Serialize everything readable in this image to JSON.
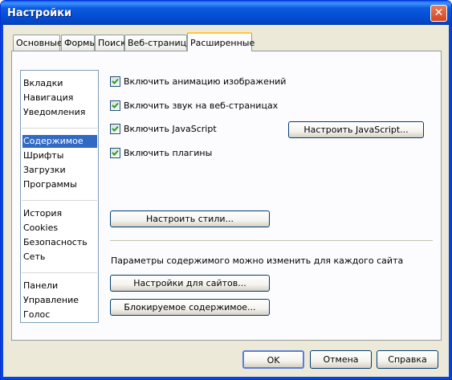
{
  "window": {
    "title": "Настройки",
    "close_glyph": "✕"
  },
  "tabs": [
    {
      "label": "Основные"
    },
    {
      "label": "Формы"
    },
    {
      "label": "Поиск"
    },
    {
      "label": "Веб-страницы"
    },
    {
      "label": "Расширенные",
      "active": true
    }
  ],
  "sidebar": {
    "groups": [
      [
        "Вкладки",
        "Навигация",
        "Уведомления"
      ],
      [
        "Содержимое",
        "Шрифты",
        "Загрузки",
        "Программы"
      ],
      [
        "История",
        "Cookies",
        "Безопасность",
        "Сеть"
      ],
      [
        "Панели",
        "Управление",
        "Голос"
      ]
    ],
    "selected": "Содержимое"
  },
  "content": {
    "checkboxes": [
      {
        "label": "Включить анимацию изображений",
        "checked": true
      },
      {
        "label": "Включить звук на веб-страницах",
        "checked": true
      },
      {
        "label": "Включить JavaScript",
        "checked": true
      },
      {
        "label": "Включить плагины",
        "checked": true
      }
    ],
    "js_button": "Настроить JavaScript...",
    "styles_button": "Настроить стили...",
    "site_note": "Параметры содержимого можно изменить для каждого сайта",
    "site_settings_button": "Настройки для сайтов...",
    "blocked_button": "Блокируемое содержимое..."
  },
  "footer": {
    "ok": "OK",
    "cancel": "Отмена",
    "help": "Справка"
  },
  "colors": {
    "titlebar": "#0A5FE6",
    "selection": "#316AC5",
    "face": "#ECE9D8",
    "check": "#21A121"
  }
}
